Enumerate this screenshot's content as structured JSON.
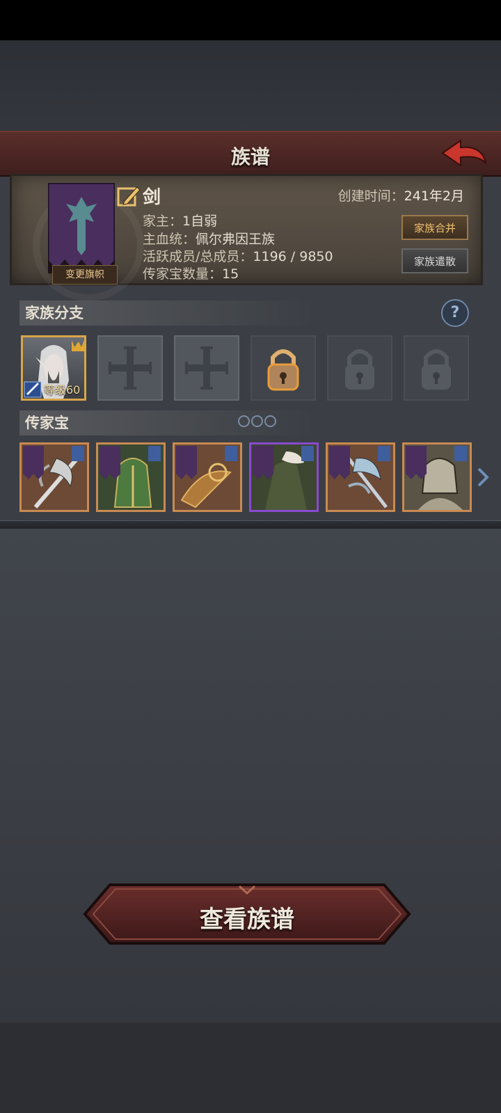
{
  "header": {
    "title": "族谱"
  },
  "clan": {
    "name": "剑",
    "change_banner_label": "变更旗帜",
    "created_label": "创建时间：",
    "created_value": "241年2月",
    "leader_label": "家主：",
    "leader_value": "1自弱",
    "bloodline_label": "主血统：",
    "bloodline_value": "佩尔弗因王族",
    "members_label": "活跃成员/总成员：",
    "members_value": "1196 / 9850",
    "heirloom_count_label": "传家宝数量：",
    "heirloom_count_value": "15",
    "merge_button": "家族合并",
    "dissolve_button": "家族遣散"
  },
  "branches": {
    "title": "家族分支",
    "help_icon": "?",
    "active_level": "等级60"
  },
  "heirlooms": {
    "title": "传家宝"
  },
  "footer": {
    "view_button": "查看族谱"
  }
}
